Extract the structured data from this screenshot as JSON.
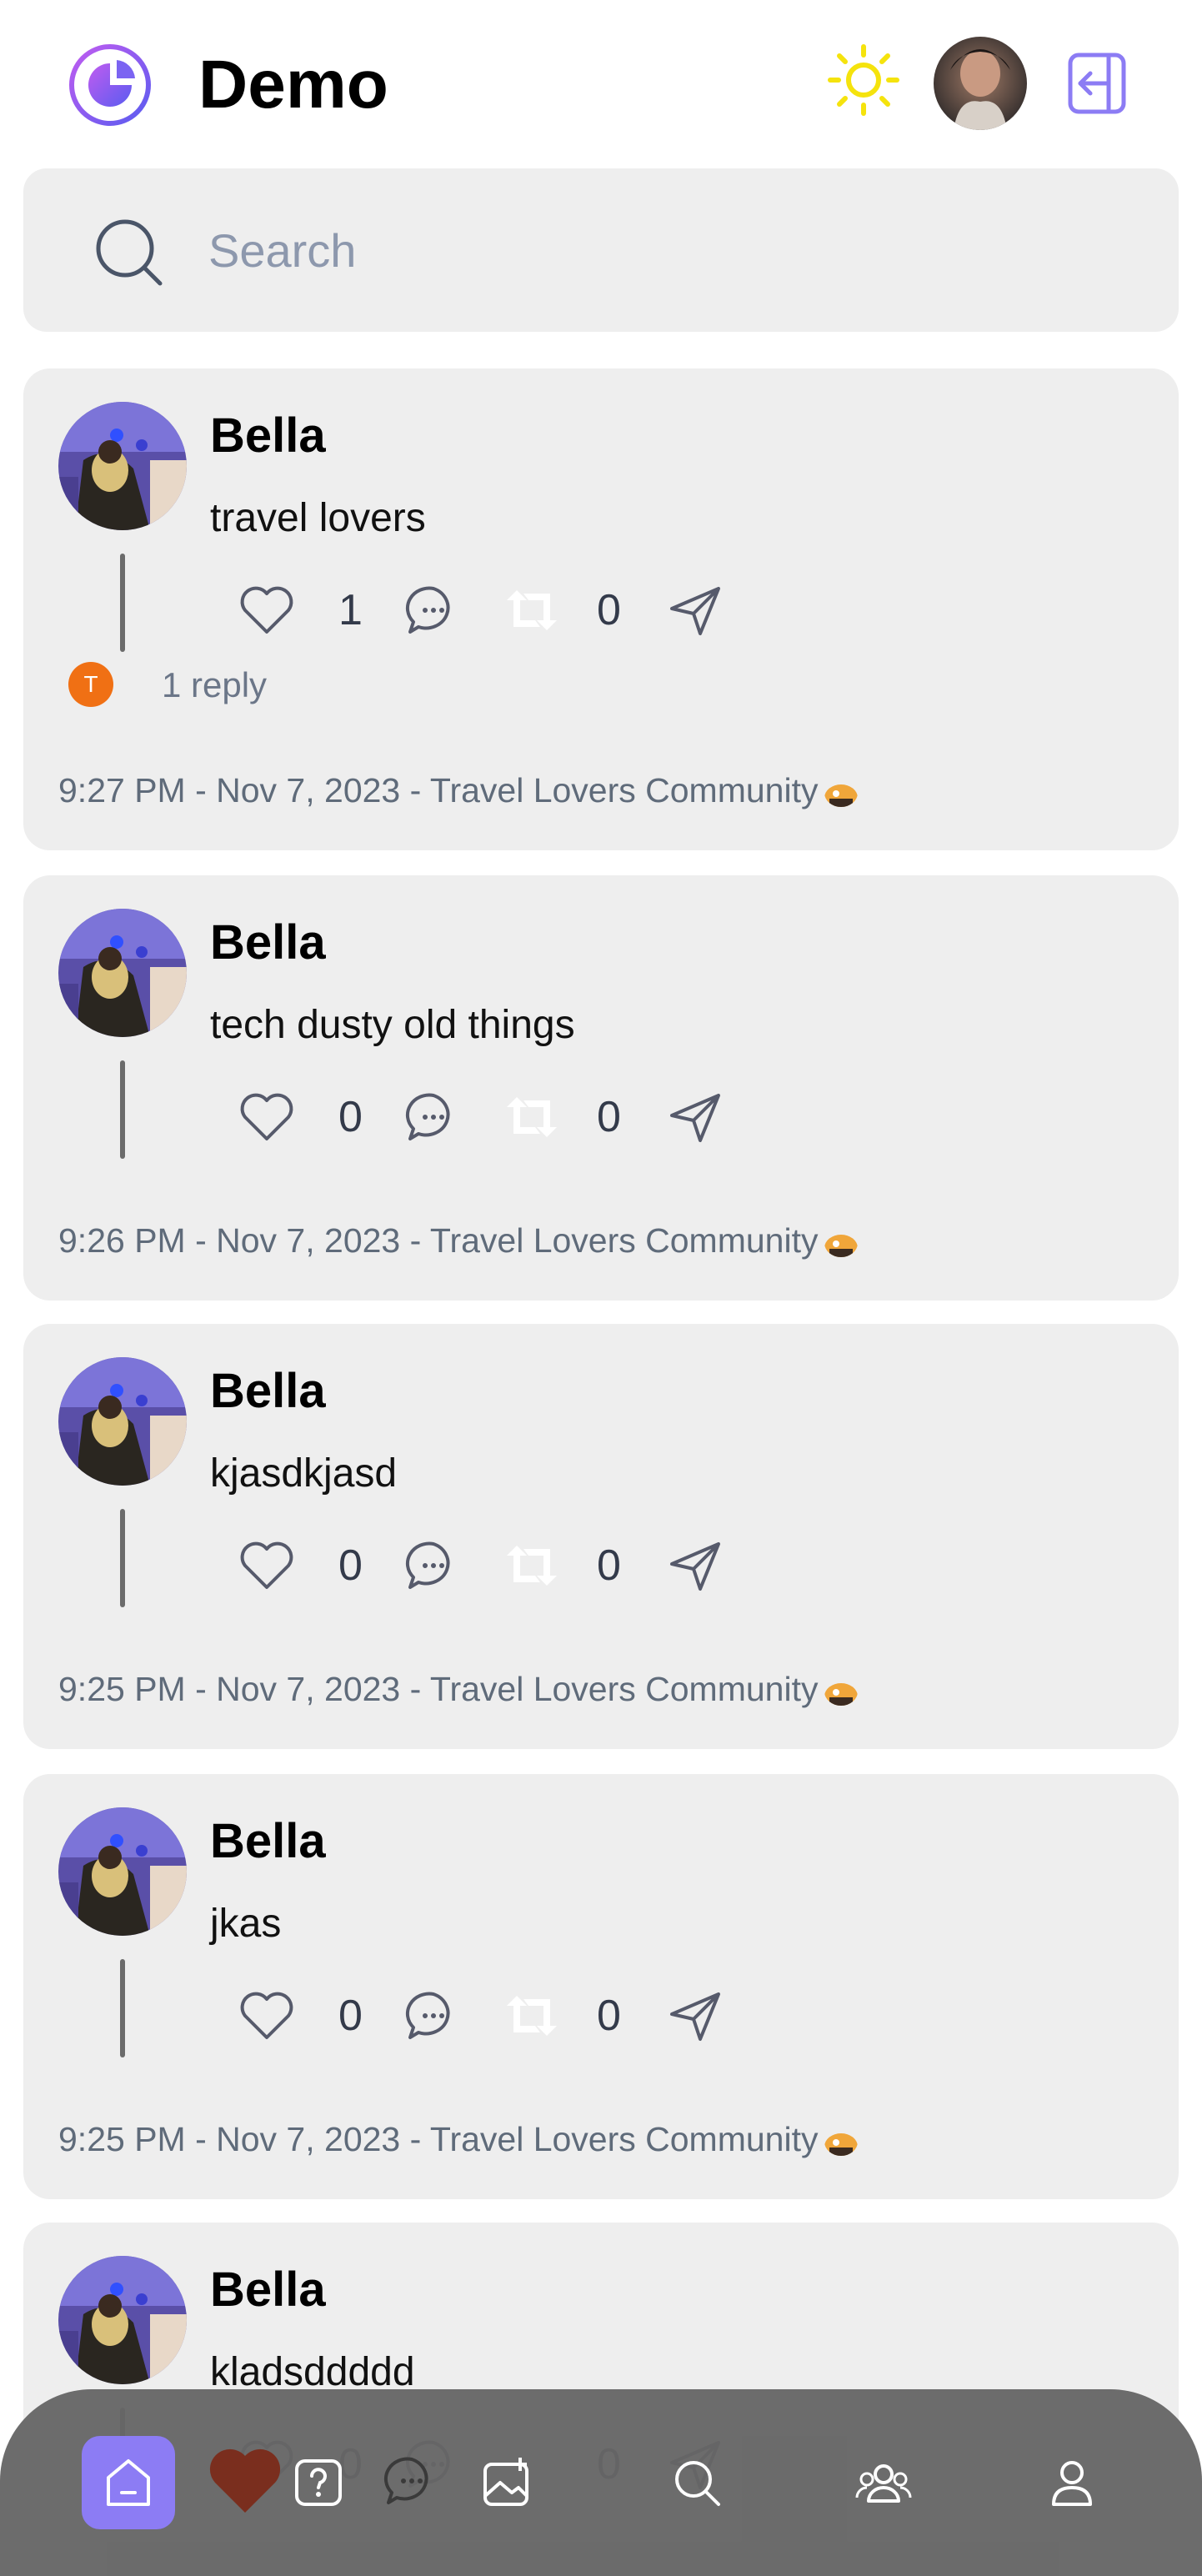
{
  "header": {
    "title": "Demo",
    "logo_icon": "moon-pie-logo",
    "theme_icon": "sun-icon",
    "logout_icon": "logout-icon"
  },
  "search": {
    "placeholder": "Search"
  },
  "colors": {
    "accent": "#8c7cf4",
    "card_bg": "#eeeeee",
    "reply_badge": "#f07014",
    "meta_text": "#5f6b7a"
  },
  "posts": [
    {
      "author": "Bella",
      "text": "travel lovers",
      "likes": "1",
      "reposts": "0",
      "reply_initial": "T",
      "reply_label": "1 reply",
      "meta": "9:27 PM - Nov 7, 2023 - Travel Lovers Community"
    },
    {
      "author": "Bella",
      "text": "tech dusty old things",
      "likes": "0",
      "reposts": "0",
      "meta": "9:26 PM - Nov 7, 2023 - Travel Lovers Community"
    },
    {
      "author": "Bella",
      "text": "kjasdkjasd",
      "likes": "0",
      "reposts": "0",
      "meta": "9:25 PM - Nov 7, 2023 - Travel Lovers Community"
    },
    {
      "author": "Bella",
      "text": "jkas",
      "likes": "0",
      "reposts": "0",
      "meta": "9:25 PM - Nov 7, 2023 - Travel Lovers Community"
    },
    {
      "author": "Bella",
      "text": "kladsddddd",
      "likes": "0",
      "reposts": "0"
    }
  ],
  "bottom_nav": {
    "items": [
      "home-icon",
      "heart-icon",
      "question-icon",
      "chat-icon",
      "add-image-icon",
      "search-icon",
      "community-icon",
      "profile-icon"
    ]
  }
}
